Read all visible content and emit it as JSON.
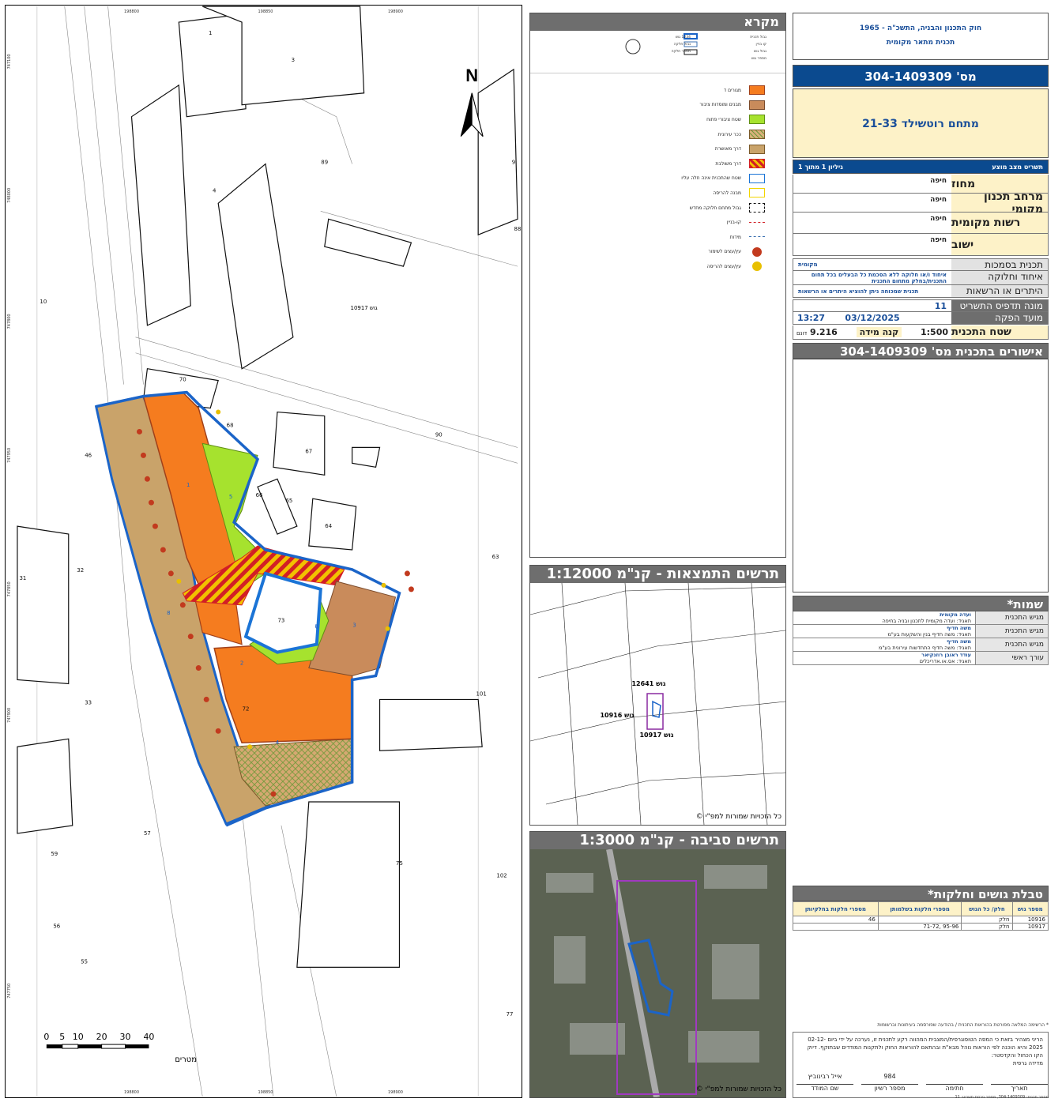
{
  "header": {
    "law": "חוק התכנון והבניה, התשכ\"ה - 1965",
    "plan_kind": "תכנית מתאר מקומית",
    "plan_number_bar": "מס' 304-1409309",
    "plan_name": "מתחם רוטשילד 21-33",
    "sheet_label": "תשריט מצב מוצע",
    "sheet_pages": "גיליון 1  מתוך 1"
  },
  "info_rows": [
    {
      "key": "מחוז",
      "value": "חיפה"
    },
    {
      "key": "מרחב תכנון מקומי",
      "value": "חיפה"
    },
    {
      "key": "רשות מקומית",
      "value": "חיפה"
    },
    {
      "key": "ישוב",
      "value": "חיפה"
    }
  ],
  "status_rows": [
    {
      "key": "תכנית בסמכות",
      "value": "מקומית"
    },
    {
      "key": "איחוד וחלוקה",
      "value": "איחוד ו/או חלוקה ללא הסכמת כל הבעלים בכל תחום התכנית/בחלק מתחום התכנית"
    },
    {
      "key": "היתרים או הרשאות",
      "value": "תכנית שמכוחה ניתן להוציא היתרים או הרשאות"
    }
  ],
  "meta_rows": [
    {
      "key": "מונה תדפיס התשריט",
      "value": "11"
    },
    {
      "key": "מועד הפקה",
      "value": "03/12/2025"
    }
  ],
  "production_time": "13:27",
  "area": {
    "label": "שטח התכנית",
    "value": "9.216",
    "unit": "דונם"
  },
  "scale": {
    "label": "קנה מידה",
    "value": "1:500"
  },
  "approvals_title": "אישורים בתכנית מס' 304-1409309",
  "legend": {
    "title": "מקרא",
    "top_items": [
      "גבול תכנית",
      "קו בניין",
      "גבול גוש",
      "מספר גוש",
      "1234 גוש",
      "גבול חלקה",
      "מספר חלקה"
    ],
    "items": [
      {
        "label": "מגורים ד",
        "color": "#f57c1f",
        "border": "#a0401a",
        "pattern": "solid"
      },
      {
        "label": "מבנים ומוסדות ציבור",
        "color": "#c98b5b",
        "border": "#7a4a2a",
        "pattern": "solid"
      },
      {
        "label": "שטח ציבורי פתוח",
        "color": "#a6e22e",
        "border": "#5f8f14",
        "pattern": "solid"
      },
      {
        "label": "ככר עירונית",
        "color": "#d9b07a",
        "border": "#7a5a2a",
        "pattern": "cross"
      },
      {
        "label": "דרך מאושרת",
        "color": "#c9a36a",
        "border": "#7a5a2a",
        "pattern": "solid"
      },
      {
        "label": "דרך משולבת",
        "color": "#f2c100",
        "border": "#d21f26",
        "pattern": "stripes"
      },
      {
        "label": "שטח שהתכנית אינה חלה עליו",
        "color": "#ffffff",
        "border": "#1b74d6",
        "pattern": "solid"
      },
      {
        "label": "מבנה להריסה",
        "color": "#ffffff",
        "border": "#f2d500",
        "pattern": "solid"
      },
      {
        "label": "גבול מתחם חלוקה מחדש",
        "color": "#ffffff",
        "border": "#111111",
        "pattern": "dashed"
      },
      {
        "label": "קו-בניין",
        "color": "#ffffff",
        "border": "#d21f26",
        "pattern": "line"
      },
      {
        "label": "מידות",
        "color": "#ffffff",
        "border": "#3a6fb0",
        "pattern": "line"
      },
      {
        "label": "עץ/עצים לשימור",
        "color": "#ffffff",
        "border": "#c23a1e",
        "pattern": "tree"
      },
      {
        "label": "עץ/עצים להריסה",
        "color": "#ffffff",
        "border": "#e8c000",
        "pattern": "tree"
      }
    ]
  },
  "inset1": {
    "title": "תרשים התמצאות - קנ\"מ 1:12000",
    "labels": [
      "גוש 12641",
      "גוש 10916",
      "גוש 10917"
    ],
    "credit": "© כל הזכויות שמורות למפ\"י"
  },
  "inset2": {
    "title": "תרשים סביבה - קנ\"מ 1:3000",
    "credit": "© כל הזכויות שמורות למפ\"י"
  },
  "names": {
    "title": "שמות*",
    "rows": [
      {
        "role": "מגיש התכנית",
        "line1": "ועדה מקומית",
        "line2": "תאגיד: ועדה מקומית לתכנון ובניה בחיפה"
      },
      {
        "role": "מגיש התכנית",
        "line1": "משה חדיף",
        "line2": "תאגיד: משה חדיף בנין והשקעות בע\"מ"
      },
      {
        "role": "מגיש התכנית",
        "line1": "משה חדיף",
        "line2": "תאגיד: משה חדיף התחדשות עירונית בע\"מ"
      },
      {
        "role": "עורך ראשי",
        "line1": "עודד ראובן רוזנקיאר",
        "line2": "תאגיד: אס.או.אדריכלים"
      }
    ]
  },
  "parcels": {
    "title": "טבלת גושים וחלקות*",
    "headers": [
      "מספר גוש",
      "חלק/ כל הגוש",
      "מספרי חלקות בשלמותן",
      "מספרי חלקות בחלקיותן"
    ],
    "rows": [
      [
        "10916",
        "חלק",
        "",
        "46"
      ],
      [
        "10917",
        "חלק",
        "95-96 ,71-72",
        ""
      ]
    ]
  },
  "footnote": "* הרשימה המלאה מפורטת בהוראות התכנית / בהודעה שפורסמה בעיתונות וברשומות",
  "survey": {
    "text": "הריני מצהיר בזאת כי המפה הטופוגרפית/המצבית המהווה רקע לתכנית זו, נערכה על ידי ביום 02-12-2025 והיא הוכנה לפי הוראות נוהל מבא\"ת ובהתאם להוראות החוק ולתקנות המודדים שבתוקף. דיוק הקו הכחול והקדסטר:",
    "accuracy": "מדידה גרפית",
    "surveyor_name": "אייל רבינוביץ",
    "license": "984",
    "sig_labels": [
      "שם המודד",
      "מספר רשיון",
      "חתימה",
      "תאריך"
    ]
  },
  "bottom_id": "מספר תכנית: 304-1409309, מספר גירסת תשריט: 11",
  "map": {
    "north": "N",
    "scale_ticks": [
      "0",
      "5",
      "10",
      "20",
      "30",
      "40"
    ],
    "scale_unit": "מטרים",
    "gush": "גוש 10917",
    "top_coords": [
      "198800",
      "198850",
      "198900"
    ],
    "bottom_coords": [
      "198800",
      "198850",
      "198900"
    ],
    "left_coords": [
      "747100",
      "748000",
      "747950",
      "747900",
      "747850",
      "747800",
      "747750"
    ],
    "parcel_labels": [
      "1",
      "3",
      "4",
      "89",
      "9",
      "88",
      "70",
      "68",
      "67",
      "90",
      "46",
      "66",
      "65",
      "64",
      "63",
      "31",
      "32",
      "73",
      "72",
      "33",
      "101",
      "57",
      "59",
      "75",
      "102",
      "56",
      "55",
      "77",
      "10"
    ],
    "plot_numbers": [
      "1",
      "5",
      "6",
      "7",
      "2",
      "3",
      "4",
      "8"
    ]
  }
}
